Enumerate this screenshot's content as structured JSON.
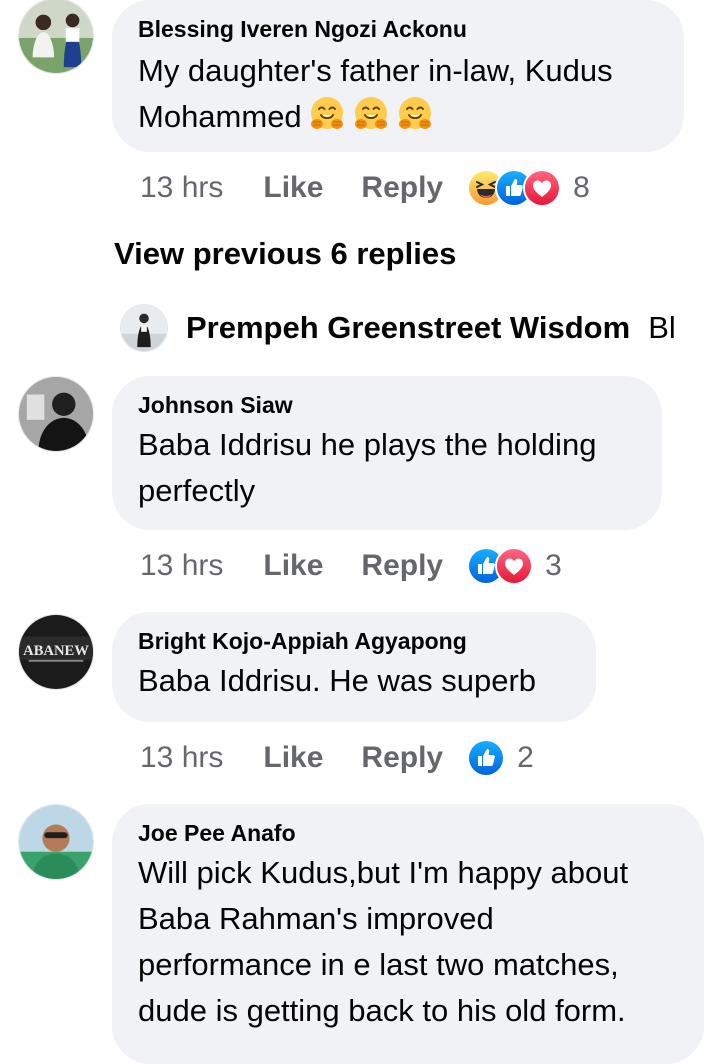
{
  "comments": [
    {
      "author": "Blessing Iveren Ngozi Ackonu",
      "text_line1": "My daughter's father in-law, Kudus",
      "text_line2": "Mohammed",
      "emojis": [
        "hugging-face-emoji",
        "hugging-face-emoji",
        "hugging-face-emoji"
      ],
      "time": "13 hrs",
      "like": "Like",
      "reply": "Reply",
      "reactions": [
        "haha",
        "like",
        "love"
      ],
      "reaction_count": "8"
    },
    {
      "author": "Johnson Siaw",
      "text": "Baba Iddrisu he plays the holding perfectly",
      "time": "13 hrs",
      "like": "Like",
      "reply": "Reply",
      "reactions": [
        "like",
        "love"
      ],
      "reaction_count": "3"
    },
    {
      "author": "Bright Kojo-Appiah Agyapong",
      "text": "Baba Iddrisu. He was superb",
      "time": "13 hrs",
      "like": "Like",
      "reply": "Reply",
      "reactions": [
        "like"
      ],
      "reaction_count": "2"
    },
    {
      "author": "Joe Pee Anafo",
      "text": "Will pick Kudus,but I'm happy about Baba Rahman's improved performance in e last two matches, dude is getting back to his old form."
    }
  ],
  "view_previous": "View previous 6 replies",
  "nested_reply": {
    "author": "Prempeh Greenstreet Wisdom",
    "text": "Bl"
  },
  "avatar_text": {
    "bright": "ABANEW"
  },
  "colors": {
    "bubble": "#f0f2f5",
    "meta": "#65676b",
    "like_blue": "#1877f2",
    "love_red": "#f33e58",
    "haha_yellow": "#f7b125"
  }
}
